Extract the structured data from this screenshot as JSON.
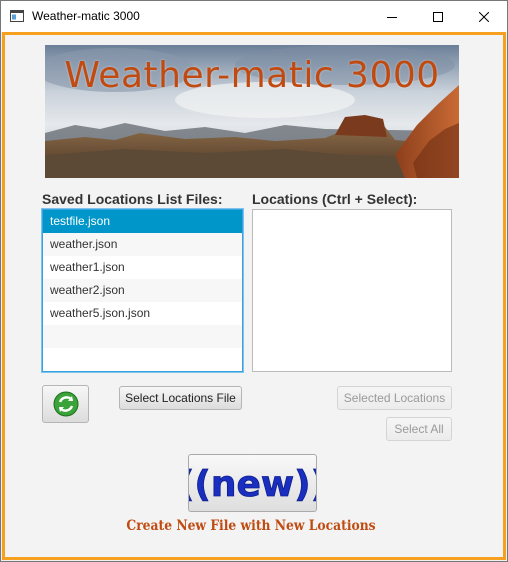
{
  "window": {
    "title": "Weather-matic 3000",
    "controls": {
      "minimize": "minimize-icon",
      "maximize": "maximize-icon",
      "close": "close-icon"
    }
  },
  "banner": {
    "title": "Weather-matic 3000"
  },
  "saved_files": {
    "heading": "Saved Locations List Files:",
    "items": [
      "testfile.json",
      "weather.json",
      "weather1.json",
      "weather2.json",
      "weather5.json.json"
    ],
    "selected": "testfile.json"
  },
  "locations": {
    "heading": "Locations (Ctrl + Select):",
    "items": []
  },
  "buttons": {
    "refresh_icon": "refresh-icon",
    "select_file": "Select Locations File",
    "selected_locations": "Selected Locations",
    "select_all": "Select All",
    "new_icon": "new-icon",
    "new_icon_text": "((new))"
  },
  "caption": "Create New File with New Locations",
  "colors": {
    "frame": "#f5a01e",
    "title_accent": "#c04a10",
    "selection": "#0096c9"
  }
}
